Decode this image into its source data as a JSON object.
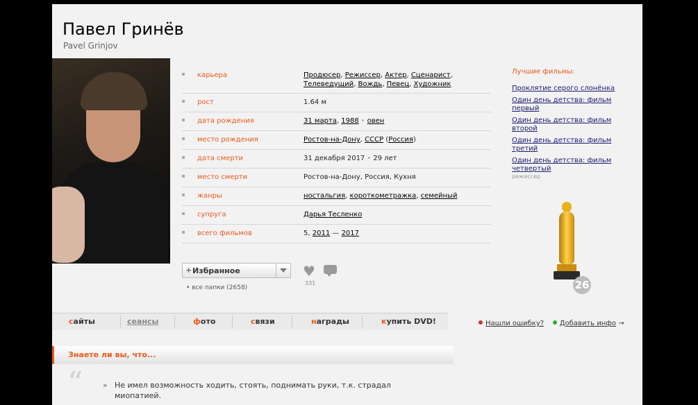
{
  "person": {
    "name": "Павел Гринёв",
    "original_name": "Pavel Grinjov"
  },
  "info": {
    "career": {
      "label": "карьера",
      "items": [
        "Продюсер",
        "Режиссер",
        "Актер",
        "Сценарист",
        "Телеведущий",
        "Вождь",
        "Певец",
        "Художник"
      ]
    },
    "height": {
      "label": "рост",
      "value": "1.64 м"
    },
    "birth_date": {
      "label": "дата рождения",
      "day_month": "31 марта",
      "year": "1988",
      "zodiac": "овен"
    },
    "birth_place": {
      "label": "место рождения",
      "city": "Ростов-на-Дону",
      "country": "СССР",
      "country_now": "Россия"
    },
    "death_date": {
      "label": "дата смерти",
      "value": "31 декабря 2017",
      "age": "29 лет"
    },
    "death_place": {
      "label": "место смерти",
      "value": "Ростов-на-Дону, Россия, Кухня"
    },
    "genres": {
      "label": "жанры",
      "items": [
        "ностальгия",
        "короткометражка",
        "семейный"
      ]
    },
    "spouse": {
      "label": "супруга",
      "value": "Дарья Тесленко"
    },
    "total_films": {
      "label": "всего фильмов",
      "count": "5",
      "from": "2011",
      "dash": "—",
      "to": "2017"
    }
  },
  "favorites": {
    "button_label": "Избранное",
    "folders_label": "• все папки (2658)",
    "likes_count": "331"
  },
  "best_films": {
    "title": "Лучшие фильмы:",
    "films": [
      "Проклятие серого слонёнка",
      "Один день детства: фильм первый",
      "Один день детства: фильм второй",
      "Один день детства: фильм третий",
      "Один день детства: фильм четвертый"
    ],
    "role": "режиссер"
  },
  "awards_count": "26",
  "tabs": [
    {
      "first": "с",
      "rest": "айты"
    },
    {
      "first": "",
      "rest": "сеансы"
    },
    {
      "first": "ф",
      "rest": "ото"
    },
    {
      "first": "с",
      "rest": "вязи"
    },
    {
      "first": "н",
      "rest": "аграды"
    },
    {
      "first": "к",
      "rest": "упить DVD!"
    }
  ],
  "actions": {
    "report_error": "Нашли ошибку?",
    "add_info": "Добавить инфо"
  },
  "did_you_know": {
    "title": "Знаете ли вы, что...",
    "fact": "Не имел возможность ходить, стоять, поднимать руки, т.к. страдал миопатией."
  },
  "colors": {
    "accent": "#e85b1c",
    "link": "#1a1a6e"
  }
}
